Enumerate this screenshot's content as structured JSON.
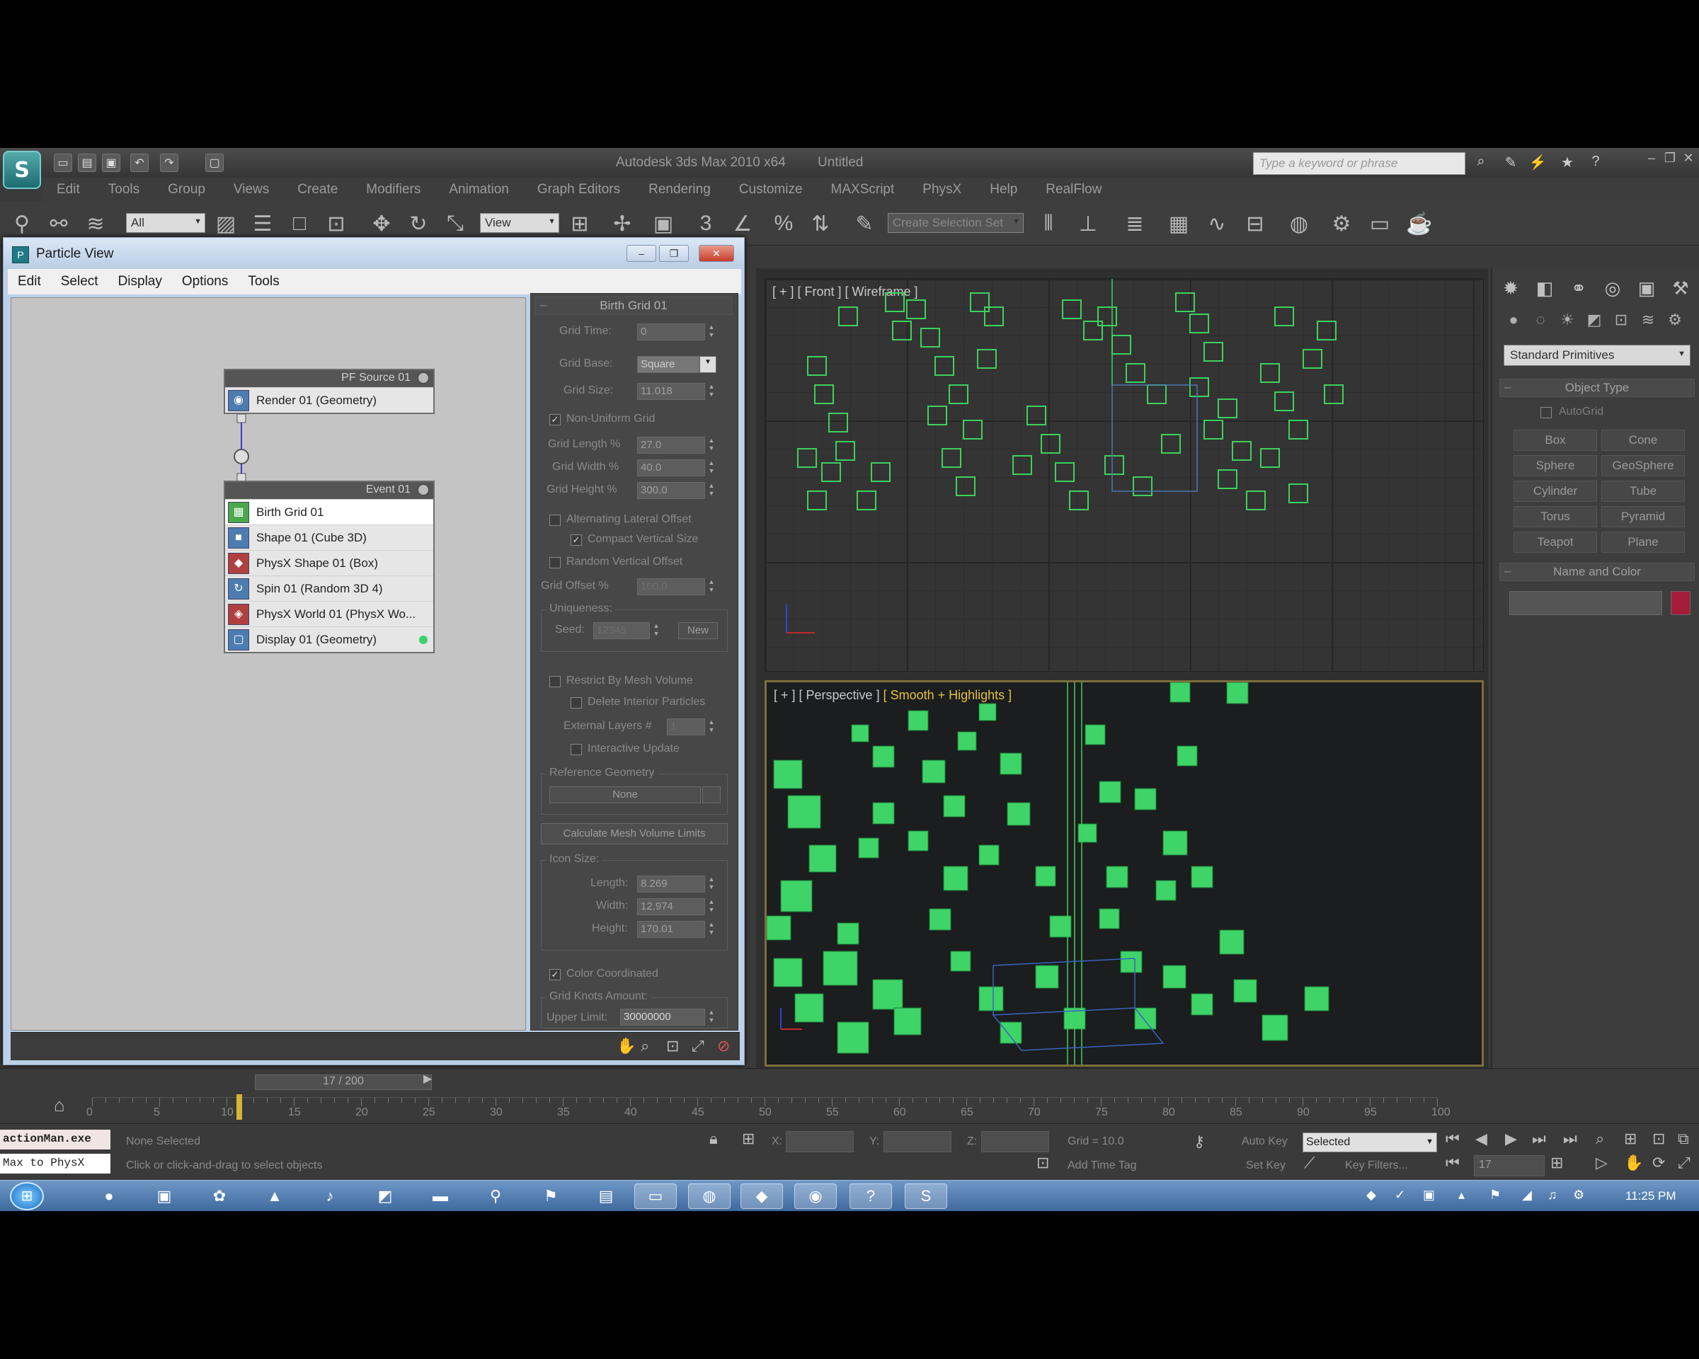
{
  "app": {
    "title": "Autodesk 3ds Max 2010 x64",
    "doc": "Untitled",
    "search_placeholder": "Type a keyword or phrase",
    "menu": [
      "Edit",
      "Tools",
      "Group",
      "Views",
      "Create",
      "Modifiers",
      "Animation",
      "Graph Editors",
      "Rendering",
      "Customize",
      "MAXScript",
      "PhysX",
      "Help",
      "RealFlow"
    ]
  },
  "toolbar": {
    "filter": "All",
    "refcoord": "View",
    "named_sel": "Create Selection Set"
  },
  "particle_view": {
    "title": "Particle View",
    "menu": [
      "Edit",
      "Select",
      "Display",
      "Options",
      "Tools"
    ],
    "source_node": {
      "title": "PF Source 01",
      "ops": [
        "Render 01 (Geometry)"
      ]
    },
    "event_node": {
      "title": "Event 01",
      "ops": [
        "Birth Grid 01",
        "Shape 01 (Cube 3D)",
        "PhysX Shape 01 (Box)",
        "Spin 01 (Random 3D 4)",
        "PhysX World 01 (PhysX Wo...",
        "Display 01 (Geometry)"
      ]
    },
    "params": {
      "rollout": "Birth Grid 01",
      "grid_time_label": "Grid Time:",
      "grid_time": "0",
      "grid_base_label": "Grid Base:",
      "grid_base": "Square",
      "grid_size_label": "Grid Size:",
      "grid_size": "11.018",
      "non_uniform": "Non-Uniform Grid",
      "grid_length_label": "Grid Length %",
      "grid_length": "27.0",
      "grid_width_label": "Grid Width %",
      "grid_width": "40.0",
      "grid_height_label": "Grid Height %",
      "grid_height": "300.0",
      "alt_lateral": "Alternating Lateral Offset",
      "compact_vertical": "Compact Vertical Size",
      "random_vertical": "Random Vertical Offset",
      "grid_offset_label": "Grid Offset %",
      "grid_offset": "100.0",
      "uniqueness": "Uniqueness:",
      "seed_label": "Seed:",
      "seed": "12345",
      "new": "New",
      "restrict": "Restrict By Mesh Volume",
      "delete_int": "Delete Interior Particles",
      "ext_layers_label": "External Layers #",
      "ext_layers": "1",
      "interactive": "Interactive Update",
      "ref_geom": "Reference Geometry",
      "none": "None",
      "calc_mesh": "Calculate Mesh Volume Limits",
      "icon_size": "Icon Size:",
      "length_label": "Length:",
      "length": "8.269",
      "width_label": "Width:",
      "width": "12.974",
      "height_label": "Height:",
      "height": "170.01",
      "color_coord": "Color Coordinated",
      "grid_knots": "Grid Knots Amount:",
      "upper_limit_label": "Upper Limit:",
      "upper_limit": "30000000"
    }
  },
  "viewports": {
    "front_label": "[ + ] [ Front ] [ Wireframe ]",
    "persp_label": "[ + ] [ Perspective ]",
    "persp_shade": "[ Smooth + Highlights ]"
  },
  "command_panel": {
    "category": "Standard Primitives",
    "object_type": "Object Type",
    "autogrid": "AutoGrid",
    "objects": [
      "Box",
      "Cone",
      "Sphere",
      "GeoSphere",
      "Cylinder",
      "Tube",
      "Torus",
      "Pyramid",
      "Teapot",
      "Plane"
    ],
    "name_and_color": "Name and Color",
    "swatch_color": "#a51c3a"
  },
  "timeline": {
    "frame": "17 / 200",
    "ticks": [
      "0",
      "5",
      "10",
      "15",
      "20",
      "25",
      "30",
      "35",
      "40",
      "45",
      "50",
      "55",
      "60",
      "65",
      "70",
      "75",
      "80",
      "85",
      "90",
      "95",
      "100"
    ]
  },
  "status": {
    "listener1": "actionMan.exe",
    "listener2": "Max to PhysX",
    "selection": "None Selected",
    "prompt": "Click or click-and-drag to select objects",
    "x_label": "X:",
    "y_label": "Y:",
    "z_label": "Z:",
    "grid": "Grid = 10.0",
    "add_time_tag": "Add Time Tag",
    "auto_key": "Auto Key",
    "set_key": "Set Key",
    "selected": "Selected",
    "key_filters": "Key Filters...",
    "frame_field": "17"
  },
  "taskbar": {
    "clock": "11:25 PM"
  }
}
